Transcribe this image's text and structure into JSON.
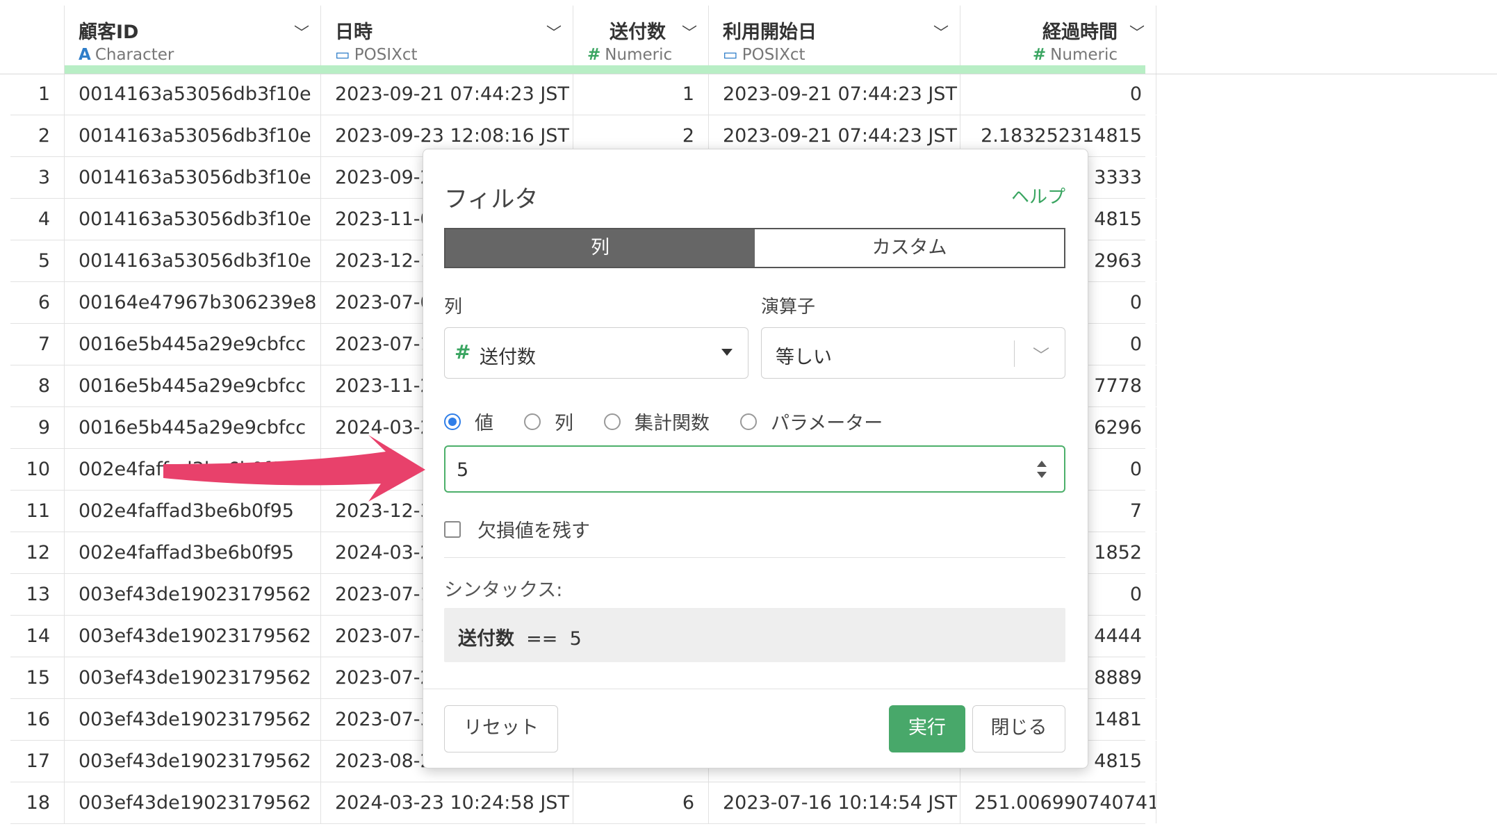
{
  "columns": [
    {
      "name": "顧客ID",
      "type": "Character",
      "icon": "character-type-icon"
    },
    {
      "name": "日時",
      "type": "POSIXct",
      "icon": "calendar-icon"
    },
    {
      "name": "送付数",
      "type": "Numeric",
      "icon": "numeric-type-icon"
    },
    {
      "name": "利用開始日",
      "type": "POSIXct",
      "icon": "calendar-icon"
    },
    {
      "name": "経過時間",
      "type": "Numeric",
      "icon": "numeric-type-icon"
    }
  ],
  "rows": [
    {
      "n": "1",
      "id": "0014163a53056db3f10e",
      "dt": "2023-09-21 07:44:23 JST",
      "cnt": "1",
      "start": "2023-09-21 07:44:23 JST",
      "elapsed": "0"
    },
    {
      "n": "2",
      "id": "0014163a53056db3f10e",
      "dt": "2023-09-23 12:08:16 JST",
      "cnt": "2",
      "start": "2023-09-21 07:44:23 JST",
      "elapsed": "2.183252314815"
    },
    {
      "n": "3",
      "id": "0014163a53056db3f10e",
      "dt": "2023-09-24",
      "cnt": "",
      "start": "",
      "elapsed": "3333"
    },
    {
      "n": "4",
      "id": "0014163a53056db3f10e",
      "dt": "2023-11-05",
      "cnt": "",
      "start": "",
      "elapsed": "4815"
    },
    {
      "n": "5",
      "id": "0014163a53056db3f10e",
      "dt": "2023-12-10",
      "cnt": "",
      "start": "",
      "elapsed": "2963"
    },
    {
      "n": "6",
      "id": "00164e47967b306239e8",
      "dt": "2023-07-06",
      "cnt": "",
      "start": "",
      "elapsed": "0"
    },
    {
      "n": "7",
      "id": "0016e5b445a29e9cbfcc",
      "dt": "2023-07-17",
      "cnt": "",
      "start": "",
      "elapsed": "0"
    },
    {
      "n": "8",
      "id": "0016e5b445a29e9cbfcc",
      "dt": "2023-11-20",
      "cnt": "",
      "start": "",
      "elapsed": "7778"
    },
    {
      "n": "9",
      "id": "0016e5b445a29e9cbfcc",
      "dt": "2024-03-23",
      "cnt": "",
      "start": "",
      "elapsed": "6296"
    },
    {
      "n": "10",
      "id": "002e4faffad3be6b0f95",
      "dt": "",
      "cnt": "",
      "start": "",
      "elapsed": "0"
    },
    {
      "n": "11",
      "id": "002e4faffad3be6b0f95",
      "dt": "2023-12-31",
      "cnt": "",
      "start": "",
      "elapsed": "7"
    },
    {
      "n": "12",
      "id": "002e4faffad3be6b0f95",
      "dt": "2024-03-23",
      "cnt": "",
      "start": "",
      "elapsed": "1852"
    },
    {
      "n": "13",
      "id": "003ef43de19023179562",
      "dt": "2023-07-16",
      "cnt": "",
      "start": "",
      "elapsed": "0"
    },
    {
      "n": "14",
      "id": "003ef43de19023179562",
      "dt": "2023-07-19",
      "cnt": "",
      "start": "",
      "elapsed": "4444"
    },
    {
      "n": "15",
      "id": "003ef43de19023179562",
      "dt": "2023-07-27",
      "cnt": "",
      "start": "",
      "elapsed": "8889"
    },
    {
      "n": "16",
      "id": "003ef43de19023179562",
      "dt": "2023-07-30",
      "cnt": "",
      "start": "",
      "elapsed": "1481"
    },
    {
      "n": "17",
      "id": "003ef43de19023179562",
      "dt": "2023-08-24",
      "cnt": "",
      "start": "",
      "elapsed": "4815"
    },
    {
      "n": "18",
      "id": "003ef43de19023179562",
      "dt": "2024-03-23 10:24:58 JST",
      "cnt": "6",
      "start": "2023-07-16 10:14:54 JST",
      "elapsed": "251.006990740741"
    }
  ],
  "dialog": {
    "title": "フィルタ",
    "help": "ヘルプ",
    "tabs": [
      "列",
      "カスタム"
    ],
    "column_label": "列",
    "operator_label": "演算子",
    "column_value": "送付数",
    "operator_value": "等しい",
    "radio_options": [
      "値",
      "列",
      "集計関数",
      "パラメーター"
    ],
    "selected_radio": "値",
    "value": "5",
    "keep_na_label": "欠損値を残す",
    "syntax_label": "シンタックス:",
    "syntax_column": "送付数",
    "syntax_op": "==",
    "syntax_value": "5",
    "reset_label": "リセット",
    "run_label": "実行",
    "close_label": "閉じる"
  },
  "colors": {
    "accent_green": "#48a86a",
    "arrow": "#e8416b",
    "radio_blue": "#2f7ee8"
  }
}
